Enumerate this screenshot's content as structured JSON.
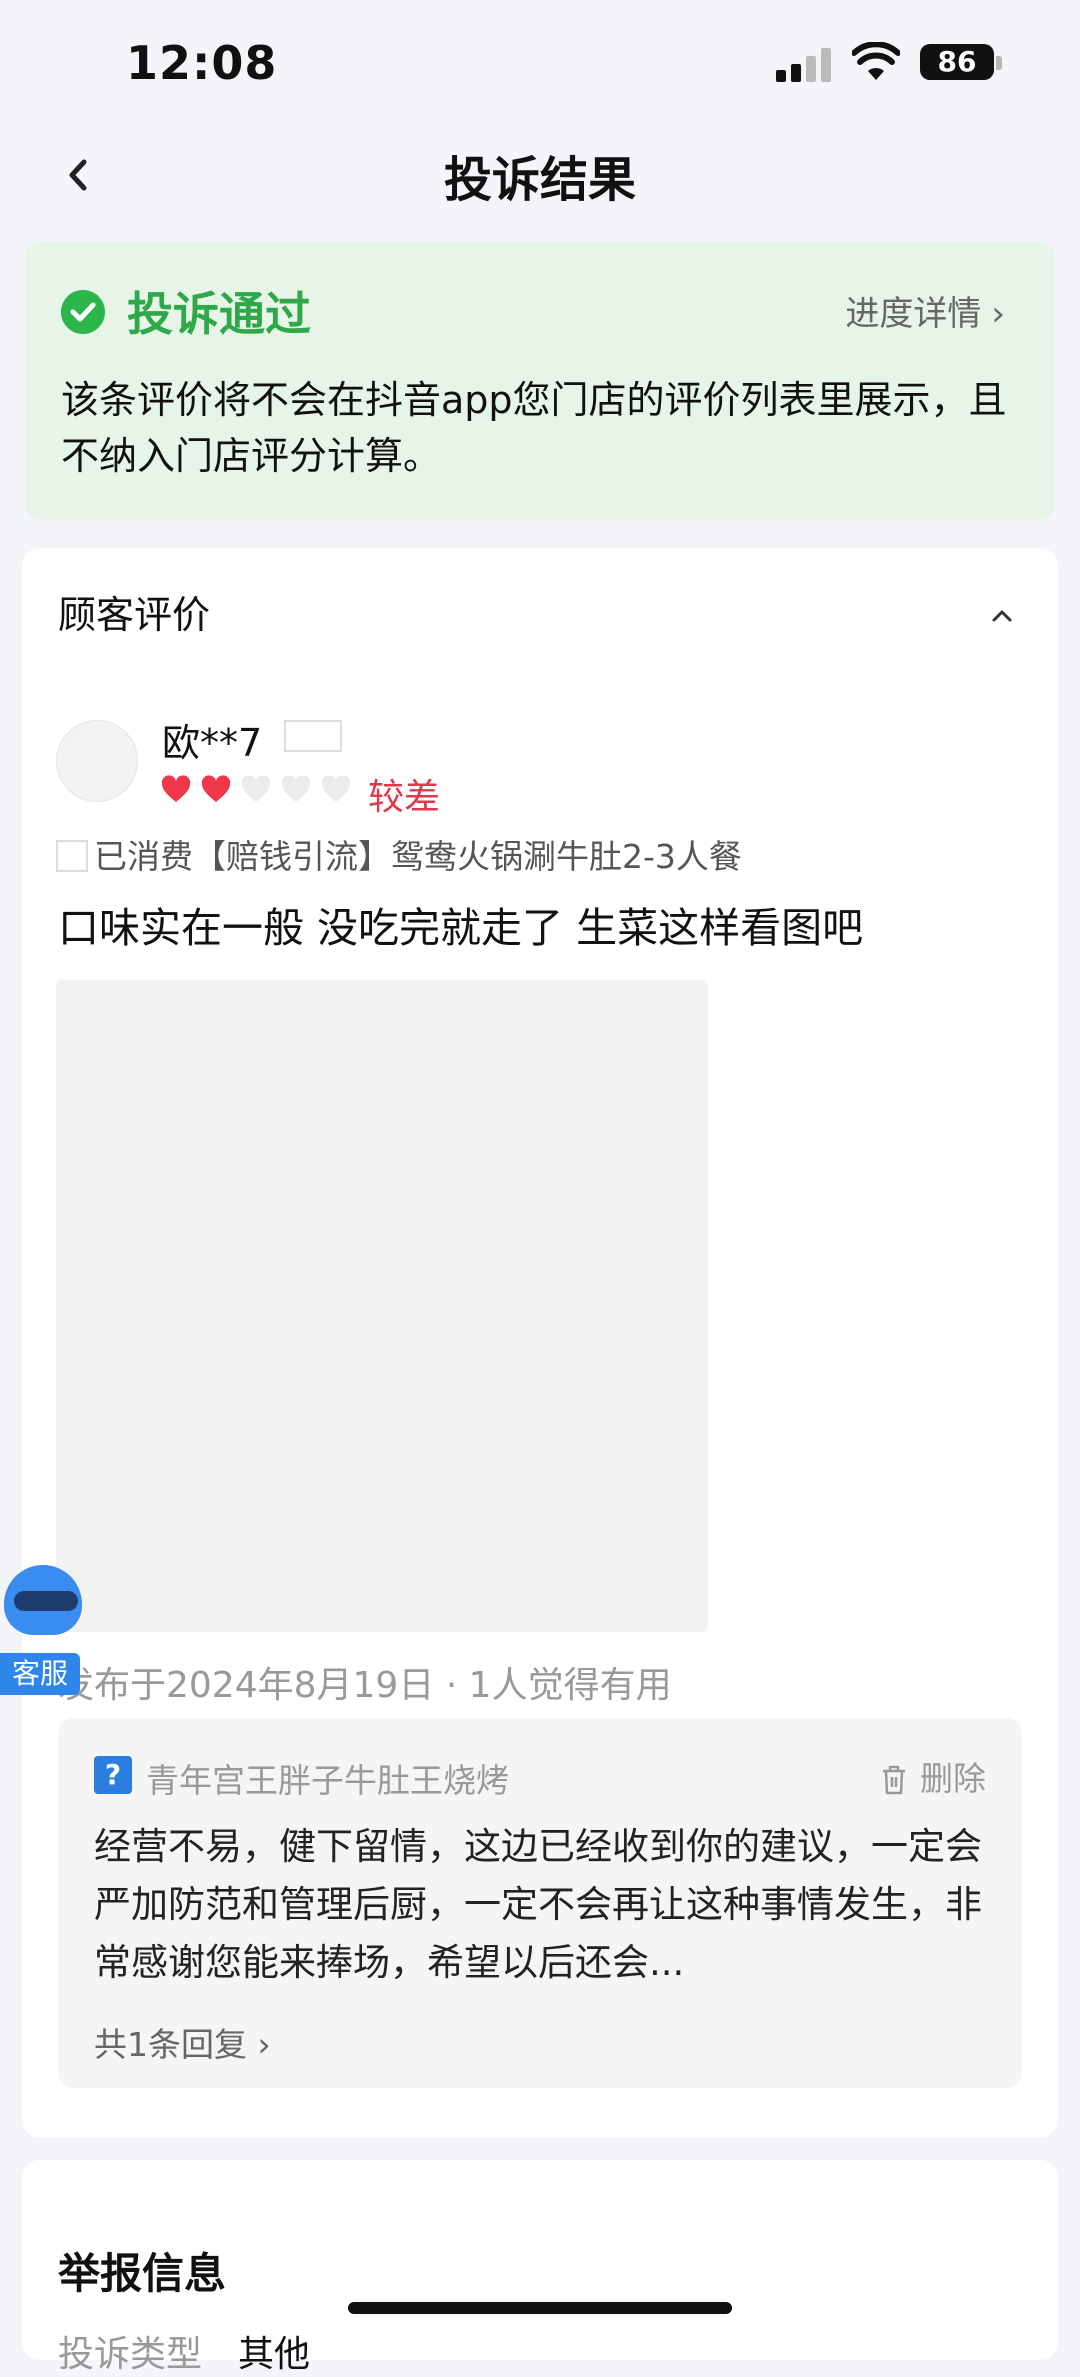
{
  "status": {
    "time": "12:08",
    "battery": "86"
  },
  "nav": {
    "title": "投诉结果"
  },
  "result": {
    "title": "投诉通过",
    "progress_link": "进度详情",
    "description": "该条评价将不会在抖音app您门店的评价列表里展示，且不纳入门店评分计算。"
  },
  "review": {
    "section_title": "顾客评价",
    "username": "欧**7",
    "rating_hearts": 2,
    "rating_max": 5,
    "rating_text": "较差",
    "consumed": "已消费【赔钱引流】鸳鸯火锅涮牛肚2-3人餐",
    "text": "口味实在一般 没吃完就走了 生菜这样看图吧",
    "meta": "发布于2024年8月19日 · 1人觉得有用"
  },
  "reply": {
    "shop_name": "青年宫王胖子牛肚王烧烤",
    "delete_label": "删除",
    "text": "经营不易，健下留情，这边已经收到你的建议，一定会严加防范和管理后厨，一定不会再让这种事情发生，非常感谢您能来捧场，希望以后还会...",
    "count": "共1条回复"
  },
  "report": {
    "title": "举报信息",
    "type_label": "投诉类型",
    "type_value": "其他"
  },
  "customer_service": {
    "label": "客服"
  },
  "colors": {
    "success": "#2fa84a",
    "warn": "#e03a4a",
    "heart": "#f0384a"
  }
}
